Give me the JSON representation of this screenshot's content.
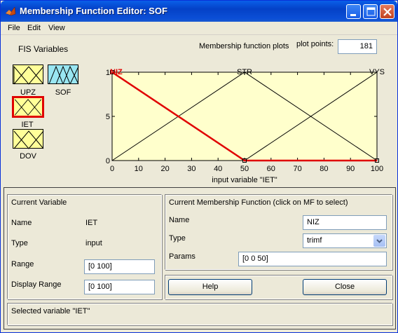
{
  "window": {
    "title": "Membership Function Editor: SOF",
    "controls": {
      "minimize": "minimize-icon",
      "maximize": "maximize-icon",
      "close": "close-icon"
    }
  },
  "menu": {
    "file": "File",
    "edit": "Edit",
    "view": "View"
  },
  "fis": {
    "heading": "FIS Variables",
    "variables": [
      {
        "name": "UPZ",
        "kind": "input"
      },
      {
        "name": "SOF",
        "kind": "output"
      },
      {
        "name": "IET",
        "kind": "input",
        "selected": true
      },
      {
        "name": "DOV",
        "kind": "input"
      }
    ]
  },
  "plot": {
    "heading": "Membership function plots",
    "points_label": "plot points:",
    "points_value": "181"
  },
  "chart_data": {
    "type": "line",
    "xlabel": "input variable \"IET\"",
    "xlim": [
      0,
      100
    ],
    "ylim": [
      0,
      1
    ],
    "xticks": [
      0,
      10,
      20,
      30,
      40,
      50,
      60,
      70,
      80,
      90,
      100
    ],
    "yticks": [
      0,
      0.5,
      1
    ],
    "background": "#ffffcc",
    "series": [
      {
        "name": "NIZ",
        "x": [
          0,
          0,
          50,
          100
        ],
        "y": [
          1,
          1,
          0,
          0
        ],
        "color": "#e00000",
        "selected": true
      },
      {
        "name": "STR",
        "x": [
          0,
          50,
          100
        ],
        "y": [
          0,
          1,
          0
        ],
        "color": "#000000"
      },
      {
        "name": "VYS",
        "x": [
          0,
          50,
          100
        ],
        "y": [
          0,
          0,
          1
        ],
        "color": "#000000"
      }
    ]
  },
  "current_variable": {
    "heading": "Current Variable",
    "name_label": "Name",
    "name_value": "IET",
    "type_label": "Type",
    "type_value": "input",
    "range_label": "Range",
    "range_value": "[0 100]",
    "display_range_label": "Display Range",
    "display_range_value": "[0 100]"
  },
  "current_mf": {
    "heading": "Current Membership Function (click on MF to select)",
    "name_label": "Name",
    "name_value": "NIZ",
    "type_label": "Type",
    "type_value": "trimf",
    "params_label": "Params",
    "params_value": "[0 0 50]"
  },
  "buttons": {
    "help": "Help",
    "close": "Close"
  },
  "status": "Selected variable \"IET\""
}
